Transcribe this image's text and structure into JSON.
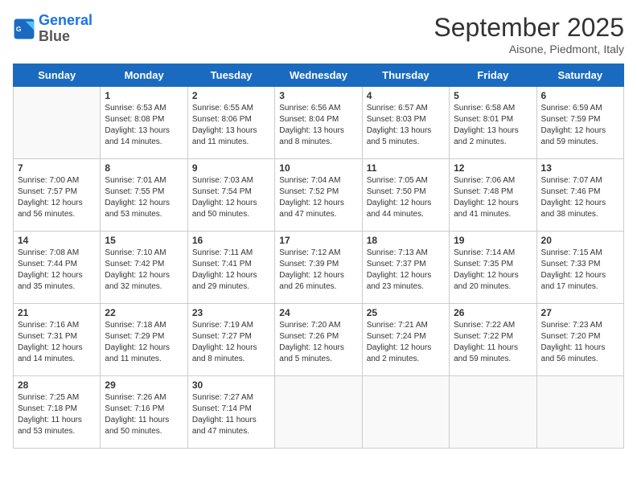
{
  "logo": {
    "line1": "General",
    "line2": "Blue"
  },
  "title": "September 2025",
  "subtitle": "Aisone, Piedmont, Italy",
  "days_of_week": [
    "Sunday",
    "Monday",
    "Tuesday",
    "Wednesday",
    "Thursday",
    "Friday",
    "Saturday"
  ],
  "weeks": [
    [
      {
        "day": null
      },
      {
        "day": 1,
        "sunrise": "6:53 AM",
        "sunset": "8:08 PM",
        "daylight": "13 hours and 14 minutes."
      },
      {
        "day": 2,
        "sunrise": "6:55 AM",
        "sunset": "8:06 PM",
        "daylight": "13 hours and 11 minutes."
      },
      {
        "day": 3,
        "sunrise": "6:56 AM",
        "sunset": "8:04 PM",
        "daylight": "13 hours and 8 minutes."
      },
      {
        "day": 4,
        "sunrise": "6:57 AM",
        "sunset": "8:03 PM",
        "daylight": "13 hours and 5 minutes."
      },
      {
        "day": 5,
        "sunrise": "6:58 AM",
        "sunset": "8:01 PM",
        "daylight": "13 hours and 2 minutes."
      },
      {
        "day": 6,
        "sunrise": "6:59 AM",
        "sunset": "7:59 PM",
        "daylight": "12 hours and 59 minutes."
      }
    ],
    [
      {
        "day": 7,
        "sunrise": "7:00 AM",
        "sunset": "7:57 PM",
        "daylight": "12 hours and 56 minutes."
      },
      {
        "day": 8,
        "sunrise": "7:01 AM",
        "sunset": "7:55 PM",
        "daylight": "12 hours and 53 minutes."
      },
      {
        "day": 9,
        "sunrise": "7:03 AM",
        "sunset": "7:54 PM",
        "daylight": "12 hours and 50 minutes."
      },
      {
        "day": 10,
        "sunrise": "7:04 AM",
        "sunset": "7:52 PM",
        "daylight": "12 hours and 47 minutes."
      },
      {
        "day": 11,
        "sunrise": "7:05 AM",
        "sunset": "7:50 PM",
        "daylight": "12 hours and 44 minutes."
      },
      {
        "day": 12,
        "sunrise": "7:06 AM",
        "sunset": "7:48 PM",
        "daylight": "12 hours and 41 minutes."
      },
      {
        "day": 13,
        "sunrise": "7:07 AM",
        "sunset": "7:46 PM",
        "daylight": "12 hours and 38 minutes."
      }
    ],
    [
      {
        "day": 14,
        "sunrise": "7:08 AM",
        "sunset": "7:44 PM",
        "daylight": "12 hours and 35 minutes."
      },
      {
        "day": 15,
        "sunrise": "7:10 AM",
        "sunset": "7:42 PM",
        "daylight": "12 hours and 32 minutes."
      },
      {
        "day": 16,
        "sunrise": "7:11 AM",
        "sunset": "7:41 PM",
        "daylight": "12 hours and 29 minutes."
      },
      {
        "day": 17,
        "sunrise": "7:12 AM",
        "sunset": "7:39 PM",
        "daylight": "12 hours and 26 minutes."
      },
      {
        "day": 18,
        "sunrise": "7:13 AM",
        "sunset": "7:37 PM",
        "daylight": "12 hours and 23 minutes."
      },
      {
        "day": 19,
        "sunrise": "7:14 AM",
        "sunset": "7:35 PM",
        "daylight": "12 hours and 20 minutes."
      },
      {
        "day": 20,
        "sunrise": "7:15 AM",
        "sunset": "7:33 PM",
        "daylight": "12 hours and 17 minutes."
      }
    ],
    [
      {
        "day": 21,
        "sunrise": "7:16 AM",
        "sunset": "7:31 PM",
        "daylight": "12 hours and 14 minutes."
      },
      {
        "day": 22,
        "sunrise": "7:18 AM",
        "sunset": "7:29 PM",
        "daylight": "12 hours and 11 minutes."
      },
      {
        "day": 23,
        "sunrise": "7:19 AM",
        "sunset": "7:27 PM",
        "daylight": "12 hours and 8 minutes."
      },
      {
        "day": 24,
        "sunrise": "7:20 AM",
        "sunset": "7:26 PM",
        "daylight": "12 hours and 5 minutes."
      },
      {
        "day": 25,
        "sunrise": "7:21 AM",
        "sunset": "7:24 PM",
        "daylight": "12 hours and 2 minutes."
      },
      {
        "day": 26,
        "sunrise": "7:22 AM",
        "sunset": "7:22 PM",
        "daylight": "11 hours and 59 minutes."
      },
      {
        "day": 27,
        "sunrise": "7:23 AM",
        "sunset": "7:20 PM",
        "daylight": "11 hours and 56 minutes."
      }
    ],
    [
      {
        "day": 28,
        "sunrise": "7:25 AM",
        "sunset": "7:18 PM",
        "daylight": "11 hours and 53 minutes."
      },
      {
        "day": 29,
        "sunrise": "7:26 AM",
        "sunset": "7:16 PM",
        "daylight": "11 hours and 50 minutes."
      },
      {
        "day": 30,
        "sunrise": "7:27 AM",
        "sunset": "7:14 PM",
        "daylight": "11 hours and 47 minutes."
      },
      {
        "day": null
      },
      {
        "day": null
      },
      {
        "day": null
      },
      {
        "day": null
      }
    ]
  ]
}
